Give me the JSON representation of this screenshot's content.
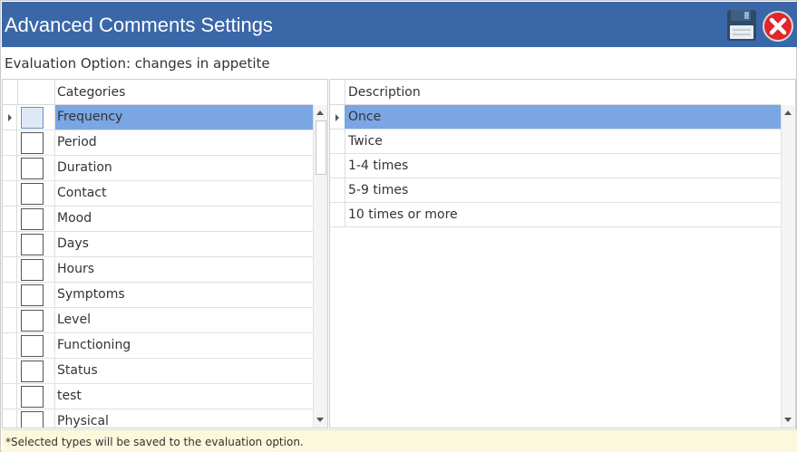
{
  "window": {
    "title": "Advanced Comments Settings",
    "save_icon": "floppy-disk-icon",
    "close_icon": "close-circle-icon",
    "accent_color": "#3a67a8",
    "selection_color": "#7aa6e4"
  },
  "subtitle": "Evaluation Option: changes in appetite",
  "categories_grid": {
    "header": "Categories",
    "selected_index": 0,
    "rows": [
      {
        "label": "Frequency",
        "checked": false
      },
      {
        "label": "Period",
        "checked": false
      },
      {
        "label": "Duration",
        "checked": false
      },
      {
        "label": "Contact",
        "checked": false
      },
      {
        "label": "Mood",
        "checked": false
      },
      {
        "label": "Days",
        "checked": false
      },
      {
        "label": "Hours",
        "checked": false
      },
      {
        "label": "Symptoms",
        "checked": false
      },
      {
        "label": "Level",
        "checked": false
      },
      {
        "label": "Functioning",
        "checked": false
      },
      {
        "label": "Status",
        "checked": false
      },
      {
        "label": "test",
        "checked": false
      },
      {
        "label": "Physical",
        "checked": false
      }
    ]
  },
  "description_grid": {
    "header": "Description",
    "selected_index": 0,
    "rows": [
      "Once",
      "Twice",
      "1-4 times",
      "5-9 times",
      "10 times or more"
    ]
  },
  "footer": {
    "note": "*Selected types will be saved to the evaluation option."
  }
}
